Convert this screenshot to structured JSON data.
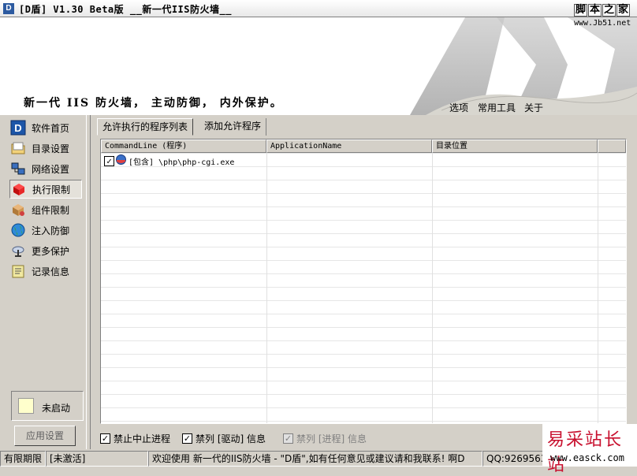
{
  "window": {
    "app_icon_letter": "D",
    "title": "[D盾] V1.30 Beta版  __新一代IIS防火墙__"
  },
  "watermark_top": {
    "chars": [
      "脚",
      "本",
      "之",
      "家"
    ],
    "url": "www.Jb51.net"
  },
  "banner": {
    "slogan": "新一代 IIS 防火墙， 主动防御， 内外保护。",
    "menu": [
      "选项",
      "常用工具",
      "关于"
    ]
  },
  "sidebar": {
    "items": [
      {
        "label": "软件首页",
        "icon": "d-logo-icon",
        "active": false
      },
      {
        "label": "目录设置",
        "icon": "folder-icon",
        "active": false
      },
      {
        "label": "网络设置",
        "icon": "network-icon",
        "active": false
      },
      {
        "label": "执行限制",
        "icon": "cube-icon",
        "active": true
      },
      {
        "label": "组件限制",
        "icon": "package-icon",
        "active": false
      },
      {
        "label": "注入防御",
        "icon": "globe-icon",
        "active": false
      },
      {
        "label": "更多保护",
        "icon": "satellite-icon",
        "active": false
      },
      {
        "label": "记录信息",
        "icon": "log-icon",
        "active": false
      }
    ],
    "status_label": "未启动",
    "apply_button": "应用设置"
  },
  "tabs": [
    {
      "label": "允许执行的程序列表",
      "active": true
    },
    {
      "label": "添加允许程序",
      "active": false
    }
  ],
  "table": {
    "columns": [
      "CommandLine (程序)",
      "ApplicationName",
      "目录位置"
    ],
    "rows": [
      {
        "checked": true,
        "commandline": "[包含] \\php\\php-cgi.exe",
        "application_name": "",
        "location": ""
      }
    ]
  },
  "options": [
    {
      "label": "禁止中止进程",
      "checked": true,
      "enabled": true
    },
    {
      "label": "禁列 [驱动] 信息",
      "checked": true,
      "enabled": true
    },
    {
      "label": "禁列 [进程] 信息",
      "checked": true,
      "enabled": false
    }
  ],
  "statusbar": {
    "license": "有限期限",
    "activation": "[未激活]",
    "message": "欢迎使用 新一代的IIS防火墙 - \"D盾\",如有任何意见或建议请和我联系! 啊D",
    "qq": "QQ:9269563"
  },
  "watermark_bottom": {
    "title": "易采站长站",
    "url": "www.easck.com"
  }
}
